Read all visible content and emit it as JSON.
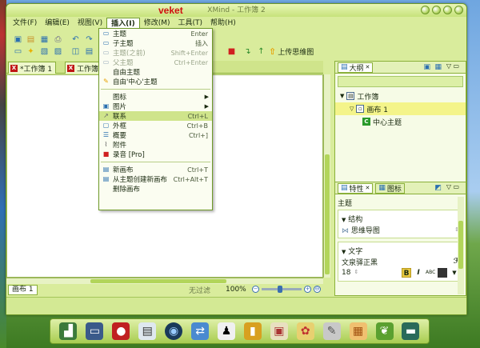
{
  "window": {
    "title": "XMind - 工作簿 2",
    "user_watermark": "veket"
  },
  "menubar": [
    "文件(F)",
    "编辑(E)",
    "视图(V)",
    "插入(I)",
    "修改(M)",
    "工具(T)",
    "帮助(H)"
  ],
  "toolbar": {
    "upload_label": "上传思维图"
  },
  "editor_tabs": [
    "*工作簿 1",
    "工作簿 2"
  ],
  "insert_menu": {
    "items": [
      {
        "label": "主题",
        "shortcut": "Enter",
        "icon": "topic-icon",
        "state": "normal"
      },
      {
        "label": "子主题",
        "shortcut": "插入",
        "icon": "subtopic-icon",
        "state": "normal"
      },
      {
        "label": "主题(之前)",
        "shortcut": "Shift+Enter",
        "icon": "topic-before-icon",
        "state": "disabled"
      },
      {
        "label": "父主题",
        "shortcut": "Ctrl+Enter",
        "icon": "parent-topic-icon",
        "state": "disabled"
      },
      {
        "label": "自由主题",
        "shortcut": "",
        "icon": "",
        "state": "normal"
      },
      {
        "label": "自由'中心'主题",
        "shortcut": "",
        "icon": "free-central-topic-icon",
        "state": "normal"
      },
      {
        "sep": true
      },
      {
        "label": "图标",
        "shortcut": "",
        "icon": "",
        "state": "normal",
        "submenu": true
      },
      {
        "label": "图片",
        "shortcut": "",
        "icon": "image-icon",
        "state": "normal",
        "submenu": true
      },
      {
        "label": "联系",
        "shortcut": "Ctrl+L",
        "icon": "relationship-icon",
        "state": "highlighted"
      },
      {
        "label": "外框",
        "shortcut": "Ctrl+B",
        "icon": "boundary-icon",
        "state": "normal"
      },
      {
        "label": "概要",
        "shortcut": "Ctrl+]",
        "icon": "summary-icon",
        "state": "normal"
      },
      {
        "label": "附件",
        "shortcut": "",
        "icon": "attachment-icon",
        "state": "normal"
      },
      {
        "label": "录音 [Pro]",
        "shortcut": "",
        "icon": "record-icon",
        "state": "normal"
      },
      {
        "sep": true
      },
      {
        "label": "新画布",
        "shortcut": "Ctrl+T",
        "icon": "new-sheet-icon",
        "state": "normal"
      },
      {
        "label": "从主题创建新画布",
        "shortcut": "Ctrl+Alt+T",
        "icon": "sheet-from-topic-icon",
        "state": "normal"
      },
      {
        "label": "删除画布",
        "shortcut": "",
        "icon": "",
        "state": "normal"
      }
    ]
  },
  "outline_panel": {
    "tab": "大纲",
    "tree": [
      {
        "label": "工作簿",
        "level": 0,
        "selected": false
      },
      {
        "label": "画布 1",
        "level": 1,
        "selected": true
      },
      {
        "label": "中心主题",
        "level": 2,
        "selected": false
      }
    ]
  },
  "properties_panel": {
    "tabs": [
      "特性",
      "图标"
    ],
    "subject": "主题",
    "structure_label": "结构",
    "structure_value": "思维导图",
    "text_label": "文字",
    "font_name": "文泉驿正黑",
    "font_size": "18",
    "abc_label": "ABC"
  },
  "statusbar": {
    "sheet": "画布 1",
    "filter": "无过滤",
    "zoom": "100%"
  },
  "taskbar_icons": [
    "chart-app-icon",
    "monitor-icon",
    "ladybug-icon",
    "files-icon",
    "speaker-icon",
    "network-icon",
    "penguin-icon",
    "door-icon",
    "photo-icon",
    "paint-icon",
    "pen-icon",
    "picture-icon",
    "leaf-icon",
    "terminal-icon"
  ]
}
